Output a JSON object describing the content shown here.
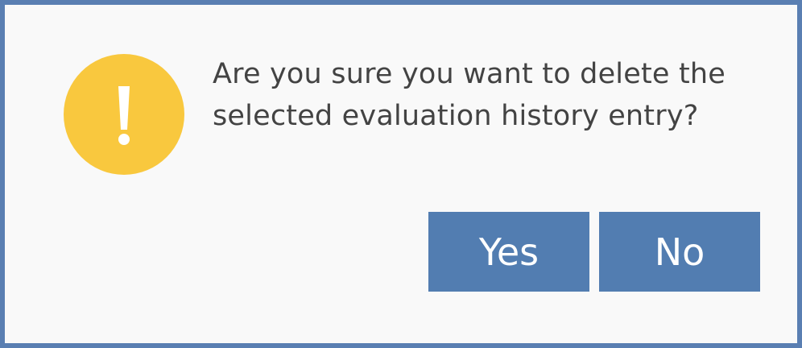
{
  "dialog": {
    "icon": "exclamation-warning-icon",
    "message": "Are you sure you want to delete the selected evaluation history entry?",
    "yes_label": "Yes",
    "no_label": "No"
  },
  "colors": {
    "border": "#5a7fb2",
    "background": "#f9f9f9",
    "icon_fill": "#f9c83e",
    "button_fill": "#527db1",
    "text": "#434343"
  }
}
